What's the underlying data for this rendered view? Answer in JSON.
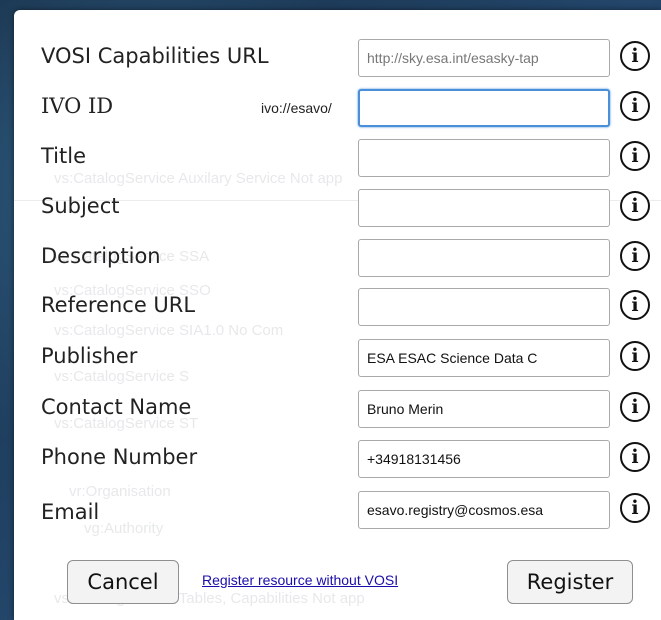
{
  "dialog": {
    "fields": [
      {
        "label": "VOSI Capabilities URL",
        "value": "",
        "placeholder": "http://sky.esa.int/esasky-tap"
      },
      {
        "label": "IVO ID",
        "prefix": "ivo://esavo/",
        "value": "",
        "placeholder": ""
      },
      {
        "label": "Title",
        "value": "",
        "placeholder": ""
      },
      {
        "label": "Subject",
        "value": "",
        "placeholder": ""
      },
      {
        "label": "Description",
        "value": "",
        "placeholder": ""
      },
      {
        "label": "Reference URL",
        "value": "",
        "placeholder": ""
      },
      {
        "label": "Publisher",
        "value": "ESA ESAC Science Data C",
        "placeholder": ""
      },
      {
        "label": "Contact Name",
        "value": "Bruno Merin",
        "placeholder": ""
      },
      {
        "label": "Phone Number",
        "value": "+34918131456",
        "placeholder": ""
      },
      {
        "label": "Email",
        "value": "esavo.registry@cosmos.esa",
        "placeholder": ""
      }
    ],
    "info_glyph": "i",
    "footer": {
      "cancel_label": "Cancel",
      "link_label": "Register resource without VOSI",
      "register_label": "Register"
    }
  },
  "background_table": [
    {
      "text": "vs:CatalogService          Auxilary Service          Not app"
    },
    {
      "text": "vs:CatalogService          SSA"
    },
    {
      "text": "vs:CatalogService          SSO"
    },
    {
      "text": "vs:CatalogService          SIA1.0          No Com"
    },
    {
      "text": "vs:CatalogService          S"
    },
    {
      "text": "vs:CatalogService          ST"
    },
    {
      "text": "vr:Organisation"
    },
    {
      "text": "vg:Authority"
    },
    {
      "text": "vs:CatalogService          Tables, Capabilities          Not app"
    }
  ],
  "colors": {
    "focus": "#4a90d9",
    "link": "#1a0dab"
  }
}
